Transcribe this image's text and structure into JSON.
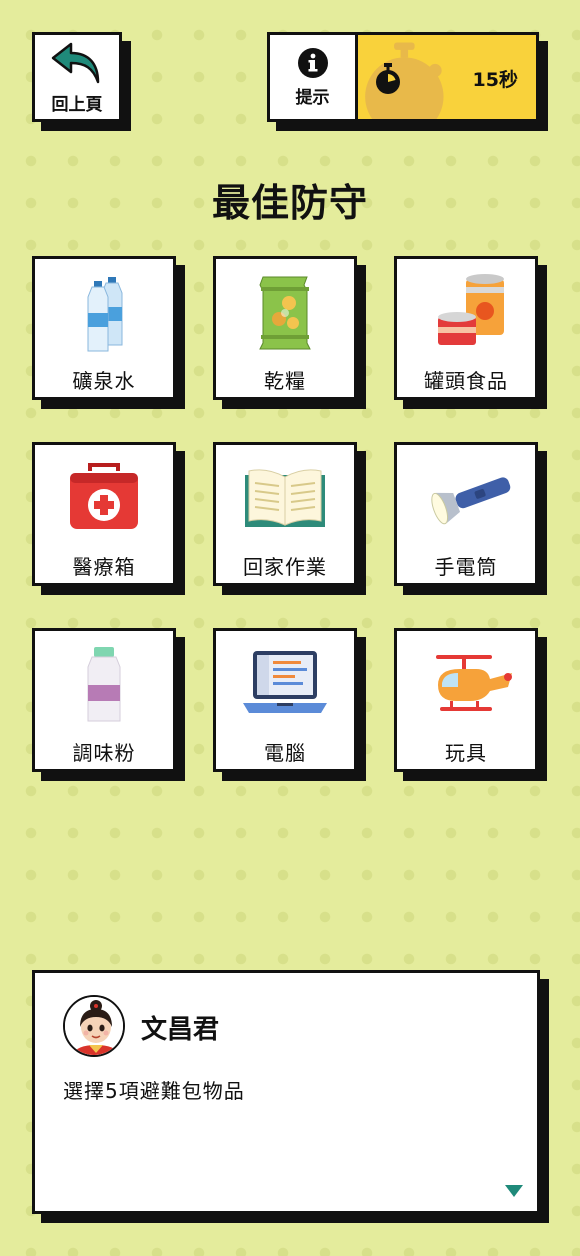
{
  "nav": {
    "back_label": "回上頁",
    "hint_label": "提示"
  },
  "timer": {
    "text": "15秒"
  },
  "title": "最佳防守",
  "items": [
    {
      "label": "礦泉水",
      "icon": "water-bottles-icon"
    },
    {
      "label": "乾糧",
      "icon": "snack-bag-icon"
    },
    {
      "label": "罐頭食品",
      "icon": "canned-food-icon"
    },
    {
      "label": "醫療箱",
      "icon": "first-aid-kit-icon"
    },
    {
      "label": "回家作業",
      "icon": "open-book-icon"
    },
    {
      "label": "手電筒",
      "icon": "flashlight-icon"
    },
    {
      "label": "調味粉",
      "icon": "seasoning-bottle-icon"
    },
    {
      "label": "電腦",
      "icon": "laptop-icon"
    },
    {
      "label": "玩具",
      "icon": "toy-helicopter-icon"
    }
  ],
  "dialog": {
    "speaker": "文昌君",
    "text": "選擇5項避難包物品"
  },
  "colors": {
    "background": "#e4ec9c",
    "timer": "#f9d23b",
    "accent": "#1f8a7a"
  }
}
